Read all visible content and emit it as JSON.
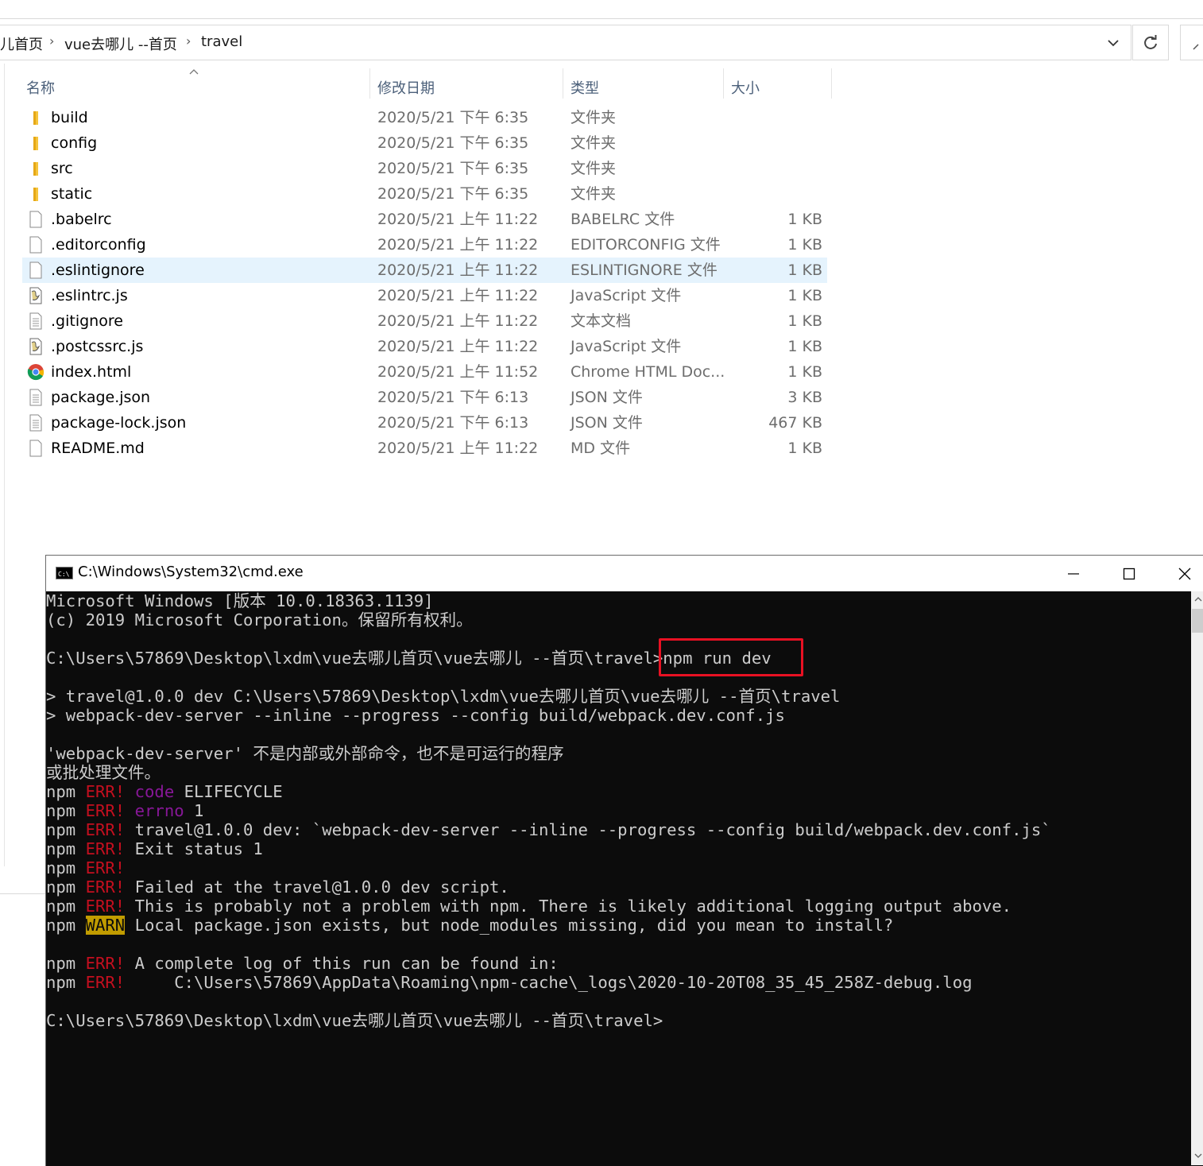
{
  "explorer": {
    "breadcrumb": [
      "儿首页",
      "vue去哪儿 --首页",
      "travel"
    ],
    "columns": {
      "name": "名称",
      "date": "修改日期",
      "type": "类型",
      "size": "大小"
    },
    "files": [
      {
        "name": "build",
        "date": "2020/5/21 下午 6:35",
        "type": "文件夹",
        "size": "",
        "icon": "folder-icon"
      },
      {
        "name": "config",
        "date": "2020/5/21 下午 6:35",
        "type": "文件夹",
        "size": "",
        "icon": "folder-icon"
      },
      {
        "name": "src",
        "date": "2020/5/21 下午 6:35",
        "type": "文件夹",
        "size": "",
        "icon": "folder-icon"
      },
      {
        "name": "static",
        "date": "2020/5/21 下午 6:35",
        "type": "文件夹",
        "size": "",
        "icon": "folder-icon"
      },
      {
        "name": ".babelrc",
        "date": "2020/5/21 上午 11:22",
        "type": "BABELRC 文件",
        "size": "1 KB",
        "icon": "blank-file-icon"
      },
      {
        "name": ".editorconfig",
        "date": "2020/5/21 上午 11:22",
        "type": "EDITORCONFIG 文件",
        "size": "1 KB",
        "icon": "blank-file-icon"
      },
      {
        "name": ".eslintignore",
        "date": "2020/5/21 上午 11:22",
        "type": "ESLINTIGNORE 文件",
        "size": "1 KB",
        "icon": "blank-file-icon",
        "selected": true
      },
      {
        "name": ".eslintrc.js",
        "date": "2020/5/21 上午 11:22",
        "type": "JavaScript 文件",
        "size": "1 KB",
        "icon": "script-file-icon"
      },
      {
        "name": ".gitignore",
        "date": "2020/5/21 上午 11:22",
        "type": "文本文档",
        "size": "1 KB",
        "icon": "text-file-icon"
      },
      {
        "name": ".postcssrc.js",
        "date": "2020/5/21 上午 11:22",
        "type": "JavaScript 文件",
        "size": "1 KB",
        "icon": "script-file-icon"
      },
      {
        "name": "index.html",
        "date": "2020/5/21 上午 11:52",
        "type": "Chrome HTML Doc...",
        "size": "1 KB",
        "icon": "chrome-icon"
      },
      {
        "name": "package.json",
        "date": "2020/5/21 下午 6:13",
        "type": "JSON 文件",
        "size": "3 KB",
        "icon": "text-file-icon"
      },
      {
        "name": "package-lock.json",
        "date": "2020/5/21 下午 6:13",
        "type": "JSON 文件",
        "size": "467 KB",
        "icon": "text-file-icon"
      },
      {
        "name": "README.md",
        "date": "2020/5/21 上午 11:22",
        "type": "MD 文件",
        "size": "1 KB",
        "icon": "blank-file-icon"
      }
    ]
  },
  "cmd": {
    "title": "C:\\Windows\\System32\\cmd.exe",
    "lines": [
      [
        {
          "t": "Microsoft Windows [版本 10.0.18363.1139]"
        }
      ],
      [
        {
          "t": "(c) 2019 Microsoft Corporation。保留所有权利。"
        }
      ],
      [],
      [
        {
          "t": "C:\\Users\\57869\\Desktop\\lxdm\\vue去哪儿首页\\vue去哪儿 --首页\\travel>npm run dev"
        }
      ],
      [],
      [
        {
          "t": "> travel@1.0.0 dev C:\\Users\\57869\\Desktop\\lxdm\\vue去哪儿首页\\vue去哪儿 --首页\\travel"
        }
      ],
      [
        {
          "t": "> webpack-dev-server --inline --progress --config build/webpack.dev.conf.js"
        }
      ],
      [],
      [
        {
          "t": "'webpack-dev-server' 不是内部或外部命令，也不是可运行的程序"
        }
      ],
      [
        {
          "t": "或批处理文件。"
        }
      ],
      [
        {
          "t": "npm "
        },
        {
          "t": "ERR!",
          "c": "err"
        },
        {
          "t": " "
        },
        {
          "t": "code",
          "c": "mag"
        },
        {
          "t": " ELIFECYCLE"
        }
      ],
      [
        {
          "t": "npm "
        },
        {
          "t": "ERR!",
          "c": "err"
        },
        {
          "t": " "
        },
        {
          "t": "errno",
          "c": "mag"
        },
        {
          "t": " 1"
        }
      ],
      [
        {
          "t": "npm "
        },
        {
          "t": "ERR!",
          "c": "err"
        },
        {
          "t": " travel@1.0.0 dev: `webpack-dev-server --inline --progress --config build/webpack.dev.conf.js`"
        }
      ],
      [
        {
          "t": "npm "
        },
        {
          "t": "ERR!",
          "c": "err"
        },
        {
          "t": " Exit status 1"
        }
      ],
      [
        {
          "t": "npm "
        },
        {
          "t": "ERR!",
          "c": "err"
        }
      ],
      [
        {
          "t": "npm "
        },
        {
          "t": "ERR!",
          "c": "err"
        },
        {
          "t": " Failed at the travel@1.0.0 dev script."
        }
      ],
      [
        {
          "t": "npm "
        },
        {
          "t": "ERR!",
          "c": "err"
        },
        {
          "t": " This is probably not a problem with npm. There is likely additional logging output above."
        }
      ],
      [
        {
          "t": "npm "
        },
        {
          "t": "WARN",
          "c": "warn"
        },
        {
          "t": " Local package.json exists, but node_modules missing, did you mean to install?"
        }
      ],
      [],
      [
        {
          "t": "npm "
        },
        {
          "t": "ERR!",
          "c": "err"
        },
        {
          "t": " A complete log of this run can be found in:"
        }
      ],
      [
        {
          "t": "npm "
        },
        {
          "t": "ERR!",
          "c": "err"
        },
        {
          "t": "     C:\\Users\\57869\\AppData\\Roaming\\npm-cache\\_logs\\2020-10-20T08_35_45_258Z-debug.log"
        }
      ],
      [],
      [
        {
          "t": "C:\\Users\\57869\\Desktop\\lxdm\\vue去哪儿首页\\vue去哪儿 --首页\\travel>"
        }
      ]
    ]
  },
  "colors": {
    "err": "#c50f1f",
    "mag": "#881798",
    "warn": "#c19c00",
    "highlight": "#e81123",
    "selection": "#e5f3fd"
  }
}
